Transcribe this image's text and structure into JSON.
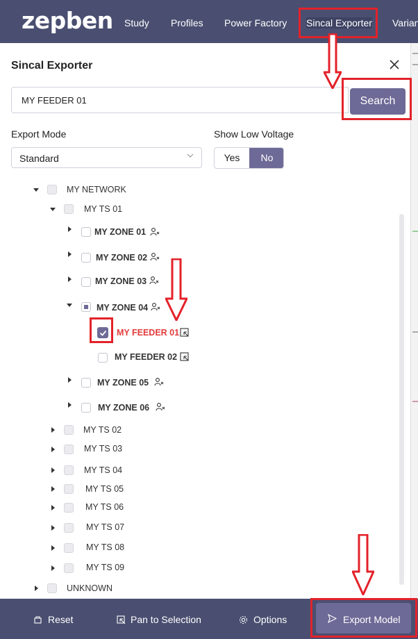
{
  "header": {
    "logo": "zepben",
    "nav": [
      "Study",
      "Profiles",
      "Power Factory",
      "Sincal Exporter",
      "Varian"
    ]
  },
  "panel": {
    "title": "Sincal Exporter",
    "search_value": "MY FEEDER 01",
    "search_label": "Search",
    "export_mode_label": "Export Mode",
    "export_mode_value": "Standard",
    "low_voltage_label": "Show Low Voltage",
    "yes_label": "Yes",
    "no_label": "No",
    "selected_low_voltage": "No"
  },
  "tree": {
    "root": "MY NETWORK",
    "ts01": "MY TS 01",
    "zones": [
      "MY ZONE 01",
      "MY ZONE 02",
      "MY ZONE 03",
      "MY ZONE 04",
      "MY ZONE 05",
      "MY ZONE 06"
    ],
    "feeders": [
      "MY FEEDER 01",
      "MY FEEDER 02"
    ],
    "other_ts": [
      "MY TS 02",
      "MY TS 03",
      "MY TS 04",
      "MY TS 05",
      "MY TS 06",
      "MY TS 07",
      "MY TS 08",
      "MY TS 09"
    ],
    "unknown": "UNKNOWN"
  },
  "footer": {
    "reset": "Reset",
    "pan": "Pan to Selection",
    "options": "Options",
    "export": "Export Model"
  },
  "colors": {
    "header_bg": "#4a4f71",
    "accent": "#6e6a97",
    "annotation": "#e3222a",
    "selected_text": "#e23b3b"
  }
}
